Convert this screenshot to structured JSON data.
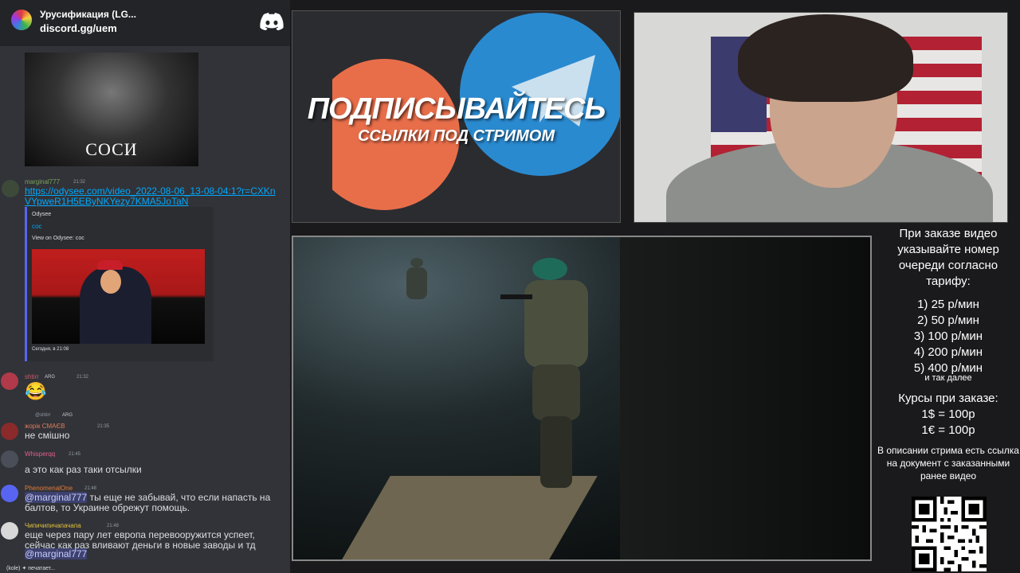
{
  "discord": {
    "server_name": "Урусификация (LG...",
    "server_link": "discord.gg/uem",
    "top_image_caption": "СОСИ",
    "messages": [
      {
        "user": "marginal777",
        "time": "21:32",
        "text": "https://odysee.com/video_2022-08-06_13-08-04:1?r=CXKnVYpweR1H5EByNKYezy7KMA5JoTaN",
        "embed": {
          "provider": "Odysee",
          "title": "сос",
          "description": "View on Odysee: сос",
          "footer": "Сегодня, в 21:08"
        }
      },
      {
        "user": "shtirr",
        "badge": "ARG",
        "time": "21:32",
        "text": "😂"
      },
      {
        "reply_to": "@shtirr",
        "reply_badge": "ARG",
        "user": "жорік СМАЄВ",
        "time": "21:35",
        "text": "не смішно"
      },
      {
        "user": "Whisperqq",
        "time": "21:45",
        "text": "а это как раз таки отсылки"
      },
      {
        "user": "PhenomenalOne",
        "time": "21:48",
        "mention": "@marginal777",
        "text": "ты еще не забывай, что если напасть на балтов, то Украине обрежут помощь."
      },
      {
        "user": "Чипичипичапачапа",
        "time": "21:48",
        "text": "еще через пару лет европа перевооружится успеет, сейчас как раз вливают деньги в новые заводы и тд",
        "mention": "@marginal777"
      }
    ],
    "typing": "(kole) ✦ печатает..."
  },
  "banner": {
    "title": "ПОДПИСЫВАЙТЕСЬ",
    "subtitle": "ССЫЛКИ ПОД СТРИМОМ"
  },
  "info": {
    "heading": "При заказе видео указывайте номер очереди согласно тарифу:",
    "tariffs": [
      "1) 25 р/мин",
      "2) 50 р/мин",
      "3) 100 р/мин",
      "4) 200 р/мин",
      "5) 400 р/мин"
    ],
    "tariffs_more": "и так далее",
    "courses_heading": "Курсы при заказе:",
    "courses": [
      "1$ = 100р",
      "1€ = 100р"
    ],
    "doc_note": "В описании стрима есть ссылка на документ с заказанными ранее видео"
  },
  "colors": {
    "chat_bg": "#313338",
    "link": "#00a8fc",
    "telegram": "#2a8ad0",
    "patreon": "#e86e4a"
  },
  "icons": [
    "discord-logo-icon",
    "server-icon",
    "emoji-icon"
  ]
}
